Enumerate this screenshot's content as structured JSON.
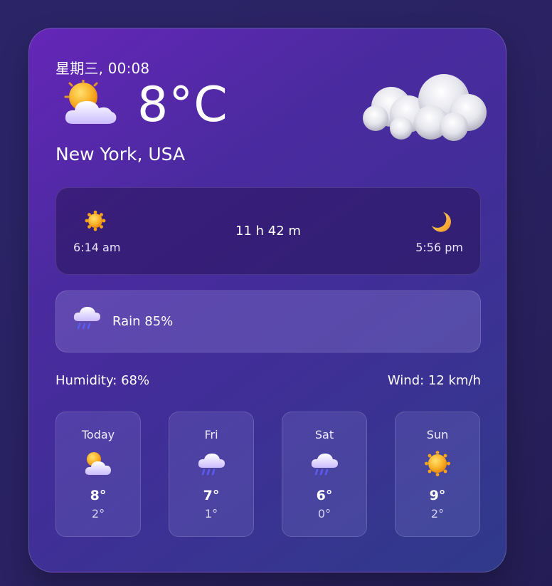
{
  "header": {
    "datetime": "星期三, 00:08",
    "temperature": "8°C",
    "location": "New York, USA",
    "current_icon": "sun-behind-cloud-icon",
    "hero_icon": "cloud-icon"
  },
  "sun": {
    "sunrise_icon": "sun-icon",
    "sunrise": "6:14 am",
    "day_length": "11 h 42 m",
    "sunset_icon": "crescent-moon-icon",
    "sunset": "5:56 pm"
  },
  "rain": {
    "icon": "rain-cloud-icon",
    "label": "Rain 85%"
  },
  "details": {
    "humidity": "Humidity: 68%",
    "wind": "Wind: 12 km/h"
  },
  "forecast": [
    {
      "day": "Today",
      "icon": "sun-behind-cloud-icon",
      "high": "8°",
      "low": "2°"
    },
    {
      "day": "Fri",
      "icon": "rain-cloud-icon",
      "high": "7°",
      "low": "1°"
    },
    {
      "day": "Sat",
      "icon": "rain-cloud-icon",
      "high": "6°",
      "low": "0°"
    },
    {
      "day": "Sun",
      "icon": "sun-icon",
      "high": "9°",
      "low": "2°"
    }
  ],
  "colors": {
    "card_gradient_start": "#6526b8",
    "card_gradient_end": "#2f3a8a",
    "background": "#2a2262",
    "sun": "#f7a21b",
    "cloud": "#ddd6ff",
    "rain": "#5a5cf0"
  }
}
